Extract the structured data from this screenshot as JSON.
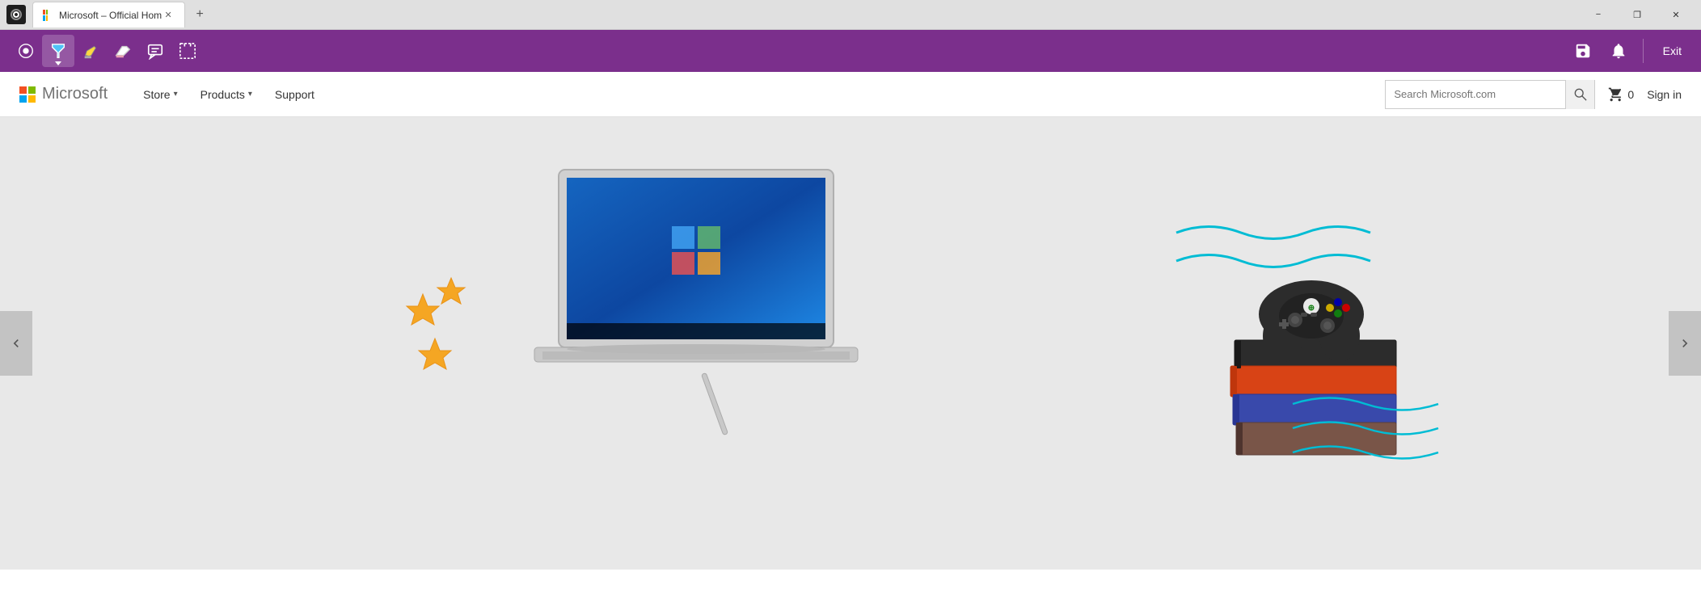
{
  "browser": {
    "tab_title": "Microsoft – Official Hom",
    "new_tab_label": "+",
    "minimize_label": "−",
    "maximize_label": "❐",
    "close_label": "✕"
  },
  "annotation_toolbar": {
    "tools": [
      {
        "name": "touch-icon",
        "label": "Touch"
      },
      {
        "name": "pen-icon",
        "label": "Pen (active)"
      },
      {
        "name": "highlighter-icon",
        "label": "Highlighter"
      },
      {
        "name": "eraser-icon",
        "label": "Eraser"
      },
      {
        "name": "comment-icon",
        "label": "Comment"
      },
      {
        "name": "clip-icon",
        "label": "Clip"
      }
    ],
    "save_label": "💾",
    "bell_label": "🔔",
    "exit_label": "Exit"
  },
  "navbar": {
    "logo_text": "Microsoft",
    "links": [
      {
        "label": "Store",
        "has_dropdown": true
      },
      {
        "label": "Products",
        "has_dropdown": true
      },
      {
        "label": "Support",
        "has_dropdown": false
      }
    ],
    "search_placeholder": "Search Microsoft.com",
    "cart_count": "0",
    "cart_label": "Cart",
    "sign_in_label": "Sign in"
  },
  "hero": {
    "left_arrow": "❮",
    "right_arrow": "❯"
  }
}
